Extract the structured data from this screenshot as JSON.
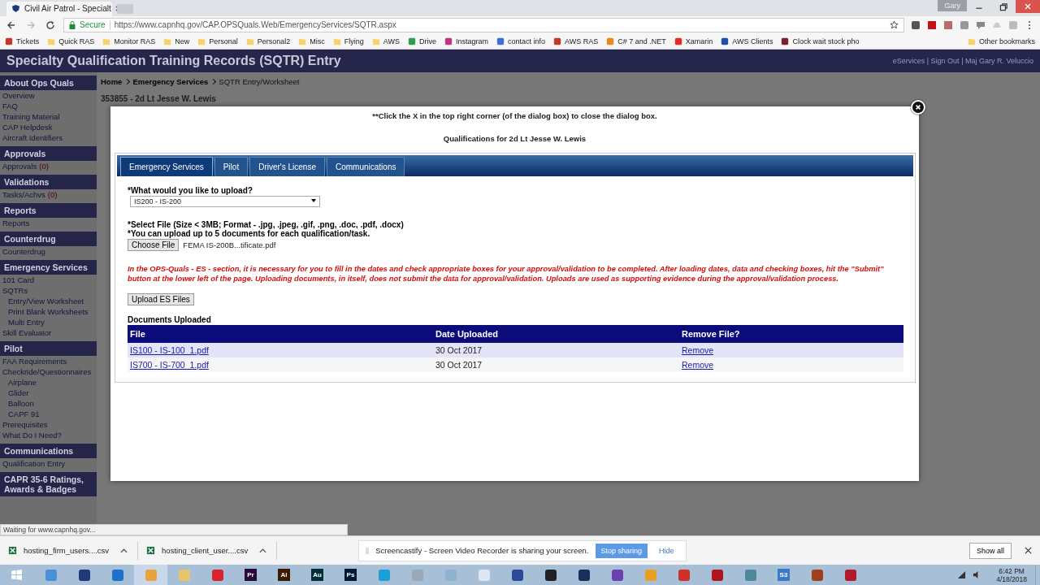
{
  "browser": {
    "tab_title": "Civil Air Patrol - Specialt",
    "secure": "Secure",
    "url": "https://www.capnhq.gov/CAP.OPSQuals.Web/EmergencyServices/SQTR.aspx",
    "profile": "Gary",
    "bookmarks": [
      {
        "label": "Tickets",
        "kind": "site",
        "color": "#c0392b"
      },
      {
        "label": "Quick RAS",
        "kind": "folder",
        "color": "#f5d26b"
      },
      {
        "label": "Monitor RAS",
        "kind": "folder",
        "color": "#f5d26b"
      },
      {
        "label": "New",
        "kind": "folder",
        "color": "#f5d26b"
      },
      {
        "label": "Personal",
        "kind": "folder",
        "color": "#f5d26b"
      },
      {
        "label": "Personal2",
        "kind": "folder",
        "color": "#f5d26b"
      },
      {
        "label": "Misc",
        "kind": "folder",
        "color": "#f5d26b"
      },
      {
        "label": "Flying",
        "kind": "folder",
        "color": "#f5d26b"
      },
      {
        "label": "AWS",
        "kind": "folder",
        "color": "#f5d26b"
      },
      {
        "label": "Drive",
        "kind": "site",
        "color": "#2f9e4f"
      },
      {
        "label": "Instagram",
        "kind": "site",
        "color": "#c13584"
      },
      {
        "label": "contact info",
        "kind": "site",
        "color": "#3b6fd6"
      },
      {
        "label": "AWS RAS",
        "kind": "site",
        "color": "#c0392b"
      },
      {
        "label": "C# 7 and .NET",
        "kind": "site",
        "color": "#e88a1a"
      },
      {
        "label": "Xamarin",
        "kind": "site",
        "color": "#e52d27"
      },
      {
        "label": "AWS Clients",
        "kind": "site",
        "color": "#1f4fa8"
      },
      {
        "label": "Clock wait stock pho",
        "kind": "site",
        "color": "#7a1f2b"
      }
    ],
    "other_bookmarks": "Other bookmarks"
  },
  "page": {
    "title": "Specialty Qualification Training Records (SQTR) Entry",
    "user_links": "eServices | Sign Out | Maj Gary R. Veluccio",
    "sidebar": [
      {
        "heading": "About Ops Quals",
        "items": [
          {
            "label": "Overview"
          },
          {
            "label": "FAQ"
          },
          {
            "label": "Training Material"
          },
          {
            "label": "CAP Helpdesk"
          },
          {
            "label": "Aircraft Identifiers"
          }
        ]
      },
      {
        "heading": "Approvals",
        "items": [
          {
            "label": "Approvals",
            "count": "(0)"
          }
        ]
      },
      {
        "heading": "Validations",
        "items": [
          {
            "label": "Tasks/Achvs",
            "count": "(0)"
          }
        ]
      },
      {
        "heading": "Reports",
        "items": [
          {
            "label": "Reports"
          }
        ]
      },
      {
        "heading": "Counterdrug",
        "items": [
          {
            "label": "Counterdrug"
          }
        ]
      },
      {
        "heading": "Emergency Services",
        "items": [
          {
            "label": "101 Card"
          },
          {
            "label": "SQTRs",
            "children": [
              {
                "label": "Entry/View Worksheet"
              },
              {
                "label": "Print Blank Worksheets"
              },
              {
                "label": "Multi Entry"
              }
            ]
          },
          {
            "label": "Skill Evaluator"
          }
        ]
      },
      {
        "heading": "Pilot",
        "items": [
          {
            "label": "FAA Requirements"
          },
          {
            "label": "Checkride/Questionnaires",
            "children": [
              {
                "label": "Airplane"
              },
              {
                "label": "Glider"
              },
              {
                "label": "Balloon"
              },
              {
                "label": "CAPF 91"
              }
            ]
          },
          {
            "label": "Prerequisites"
          },
          {
            "label": "What Do I Need?"
          }
        ]
      },
      {
        "heading": "Communications",
        "items": [
          {
            "label": "Qualification Entry"
          }
        ]
      },
      {
        "heading": "CAPR 35-6 Ratings, Awards & Badges"
      }
    ],
    "breadcrumb": [
      "Home",
      "Emergency Services",
      "SQTR Entry/Worksheet"
    ],
    "member": "353855 - 2d Lt Jesse W. Lewis"
  },
  "dialog": {
    "note": "**Click the X in the top right corner (of the dialog box) to close the dialog box.",
    "heading": "Qualifications for 2d Lt Jesse W. Lewis",
    "tabs": [
      {
        "label": "Emergency Services",
        "selected": true
      },
      {
        "label": "Pilot",
        "selected": false
      },
      {
        "label": "Driver's License",
        "selected": false
      },
      {
        "label": "Communications",
        "selected": false
      }
    ],
    "upload_label": "*What would you like to upload?",
    "upload_choice": "IS200 - IS-200",
    "file_label": "*Select File (Size < 3MB; Format - .jpg, .jpeg, .gif, .png, .doc, .pdf, .docx)",
    "file_limit": "*You can upload up to 5 documents for each qualification/task.",
    "choose_button": "Choose File",
    "chosen_file": "FEMA IS-200B...tificate.pdf",
    "warning": "In the OPS-Quals - ES - section, it is necessary for you to fill in the dates and check appropriate boxes for your approval/validation to be completed. After loading dates, data and checking boxes, hit the \"Submit\" button at the lower left of the page. Uploading documents, in itself, does not submit the data for approval/validation. Uploads are used as supporting evidence during the approval/validation process.",
    "upload_button": "Upload ES Files",
    "documents_heading": "Documents Uploaded",
    "table": {
      "columns": [
        "File",
        "Date Uploaded",
        "Remove File?"
      ],
      "rows": [
        {
          "file": "IS100 - IS-100_1.pdf",
          "date": "30 Oct 2017",
          "action": "Remove",
          "hovered": true
        },
        {
          "file": "IS700 - IS-700_1.pdf",
          "date": "30 Oct 2017",
          "action": "Remove",
          "hovered": false
        }
      ]
    }
  },
  "status": "Waiting for www.capnhq.gov...",
  "downloads": [
    "hosting_firm_users....csv",
    "hosting_client_user....csv"
  ],
  "share_notice": {
    "text": "Screencastify - Screen Video Recorder is sharing your screen.",
    "stop": "Stop sharing",
    "hide": "Hide"
  },
  "show_all": "Show all",
  "taskbar": {
    "apps": [
      {
        "kind": "glyph",
        "color": "#4a90d9"
      },
      {
        "kind": "glyph",
        "color": "#1e3a78"
      },
      {
        "kind": "glyph",
        "color": "#1a73c9"
      },
      {
        "kind": "glyph",
        "color": "#e8a33a",
        "active": true
      },
      {
        "kind": "glyph",
        "color": "#e8c46a"
      },
      {
        "kind": "glyph",
        "color": "#d9232e"
      },
      {
        "kind": "letter",
        "label": "Pr",
        "color": "#2a0a3a"
      },
      {
        "kind": "letter",
        "label": "Ai",
        "color": "#3a1a00"
      },
      {
        "kind": "letter",
        "label": "Au",
        "color": "#00303a"
      },
      {
        "kind": "letter",
        "label": "Ps",
        "color": "#001a33"
      },
      {
        "kind": "glyph",
        "color": "#1aa0d8"
      },
      {
        "kind": "glyph",
        "color": "#9aa8b8"
      },
      {
        "kind": "glyph",
        "color": "#8fb4cf"
      },
      {
        "kind": "glyph",
        "color": "#e0e6f0"
      },
      {
        "kind": "glyph",
        "color": "#2c4a9a"
      },
      {
        "kind": "glyph",
        "color": "#222222"
      },
      {
        "kind": "glyph",
        "color": "#1a2f5a"
      },
      {
        "kind": "glyph",
        "color": "#6a3fb0"
      },
      {
        "kind": "glyph",
        "color": "#e8a020"
      },
      {
        "kind": "glyph",
        "color": "#d0302a"
      },
      {
        "kind": "glyph",
        "color": "#b0141c"
      },
      {
        "kind": "glyph",
        "color": "#4a8a9a"
      },
      {
        "kind": "letter",
        "label": "S3",
        "color": "#3a7ac8"
      },
      {
        "kind": "glyph",
        "color": "#a0401a"
      },
      {
        "kind": "glyph",
        "color": "#b01a2a"
      }
    ],
    "time": "6:42 PM",
    "date": "4/18/2018"
  }
}
